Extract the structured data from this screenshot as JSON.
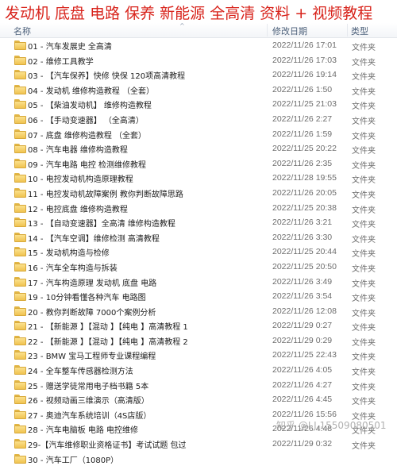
{
  "banner": {
    "text": "发动机  底盘 电路   保养 新能源   全高清  资料 + 视频教程"
  },
  "columns": {
    "name": "名称",
    "date": "修改日期",
    "type": "类型"
  },
  "items": [
    {
      "name": "01 - 汽车发展史        全高清",
      "date": "2022/11/26 17:01",
      "type": "文件夹"
    },
    {
      "name": "02 - 维修工具教学",
      "date": "2022/11/26 17:03",
      "type": "文件夹"
    },
    {
      "name": "03 - 【汽车保养】快修 快保   120项高清教程",
      "date": "2022/11/26 19:14",
      "type": "文件夹"
    },
    {
      "name": "04 - 发动机  维修构造教程     （全套）",
      "date": "2022/11/26 1:50",
      "type": "文件夹"
    },
    {
      "name": "05 - 【柴油发动机】  维修构造教程",
      "date": "2022/11/25 21:03",
      "type": "文件夹"
    },
    {
      "name": "06 - 【手动变速器】       （全高清）",
      "date": "2022/11/26 2:27",
      "type": "文件夹"
    },
    {
      "name": "07 - 底盘  维修构造教程    （全套）",
      "date": "2022/11/26 1:59",
      "type": "文件夹"
    },
    {
      "name": "08 - 汽车电器   维修构造教程",
      "date": "2022/11/25 20:22",
      "type": "文件夹"
    },
    {
      "name": "09 - 汽车电路 电控 检测维修教程",
      "date": "2022/11/26 2:35",
      "type": "文件夹"
    },
    {
      "name": "10 - 电控发动机构造原理教程",
      "date": "2022/11/28 19:55",
      "type": "文件夹"
    },
    {
      "name": "11 - 电控发动机故障案例   教你判断故障思路",
      "date": "2022/11/26 20:05",
      "type": "文件夹"
    },
    {
      "name": "12 - 电控底盘  维修构造教程",
      "date": "2022/11/25 20:38",
      "type": "文件夹"
    },
    {
      "name": "13 - 【自动变速器】全高清  维修构造教程",
      "date": "2022/11/26 3:21",
      "type": "文件夹"
    },
    {
      "name": "14 - 【汽车空调】维修检测  高清教程",
      "date": "2022/11/26 3:30",
      "type": "文件夹"
    },
    {
      "name": "15 - 发动机构造与检修",
      "date": "2022/11/25 20:44",
      "type": "文件夹"
    },
    {
      "name": "16 - 汽车全车构造与拆装",
      "date": "2022/11/25 20:50",
      "type": "文件夹"
    },
    {
      "name": "17 - 汽车构造原理   发动机  底盘  电路",
      "date": "2022/11/26 3:49",
      "type": "文件夹"
    },
    {
      "name": "19 - 10分钟看懂各种汽车  电路图",
      "date": "2022/11/26 3:54",
      "type": "文件夹"
    },
    {
      "name": "20 -  教你判断故障    7000个案例分析",
      "date": "2022/11/26 12:08",
      "type": "文件夹"
    },
    {
      "name": "21 - 【新能源 】【混动 】【纯电 】高清教程 1",
      "date": "2022/11/29 0:27",
      "type": "文件夹"
    },
    {
      "name": "22 - 【新能源 】【混动 】【纯电 】高清教程 2",
      "date": "2022/11/29 0:29",
      "type": "文件夹"
    },
    {
      "name": "23 - BMW 宝马工程师专业课程编程",
      "date": "2022/11/25 22:43",
      "type": "文件夹"
    },
    {
      "name": "24 - 全车整车传感器检测方法",
      "date": "2022/11/26 4:05",
      "type": "文件夹"
    },
    {
      "name": "25 - 赠送学徒常用电子档书籍  5本",
      "date": "2022/11/26 4:27",
      "type": "文件夹"
    },
    {
      "name": "26 - 视频动画三维演示（高清版）",
      "date": "2022/11/26 4:45",
      "type": "文件夹"
    },
    {
      "name": "27 -  奥迪汽车系统培训（4S店版）",
      "date": "2022/11/26 15:56",
      "type": "文件夹"
    },
    {
      "name": "28 - 汽车电脑板 电路  电控维修",
      "date": "2022/11/26 4:48",
      "type": "文件夹"
    },
    {
      "name": "29-【汽车维修职业资格证书】考试试题    包过",
      "date": "2022/11/29 0:32",
      "type": "文件夹"
    },
    {
      "name": "30 -   汽车工厂（1080P）",
      "date": "",
      "type": ""
    }
  ],
  "watermark": "知乎 @I.J.15509080501"
}
